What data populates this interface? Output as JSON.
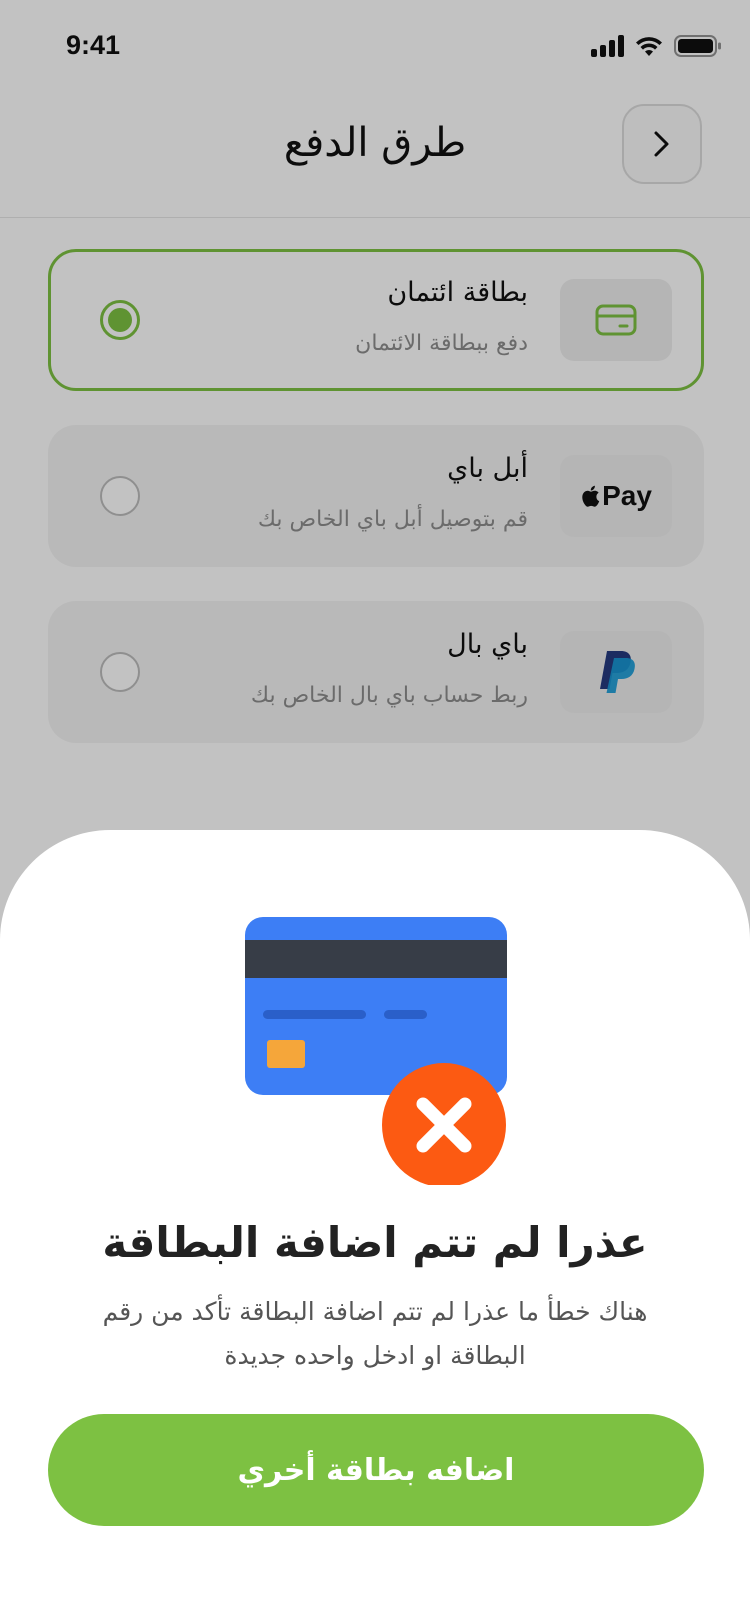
{
  "status_bar": {
    "time": "9:41"
  },
  "header": {
    "title": "طرق الدفع"
  },
  "payment_options": [
    {
      "title": "بطاقة ائتمان",
      "subtitle": "دفع ببطاقة الائتمان",
      "icon": "credit-card-icon",
      "selected": true
    },
    {
      "title": "أبل باي",
      "subtitle": "قم بتوصيل أبل باي الخاص بك",
      "icon": "apple-pay-logo",
      "logo_text": "Pay",
      "selected": false
    },
    {
      "title": "باي بال",
      "subtitle": "ربط حساب باي بال الخاص بك",
      "icon": "paypal-logo",
      "selected": false
    }
  ],
  "sheet": {
    "title": "عذرا لم تتم اضافة البطاقة",
    "message": "هناك خطأ ما عذرا لم تتم اضافة البطاقة تأكد من رقم البطاقة او ادخل واحده جديدة",
    "button_label": "اضافه بطاقة أخري"
  },
  "colors": {
    "accent": "#7dc142",
    "card_blue": "#3d7ef5",
    "card_stripe": "#373d47",
    "error_orange": "#fc5a12",
    "chip": "#f5a63a",
    "paypal_dark": "#253b80",
    "paypal_light": "#179bd7"
  }
}
